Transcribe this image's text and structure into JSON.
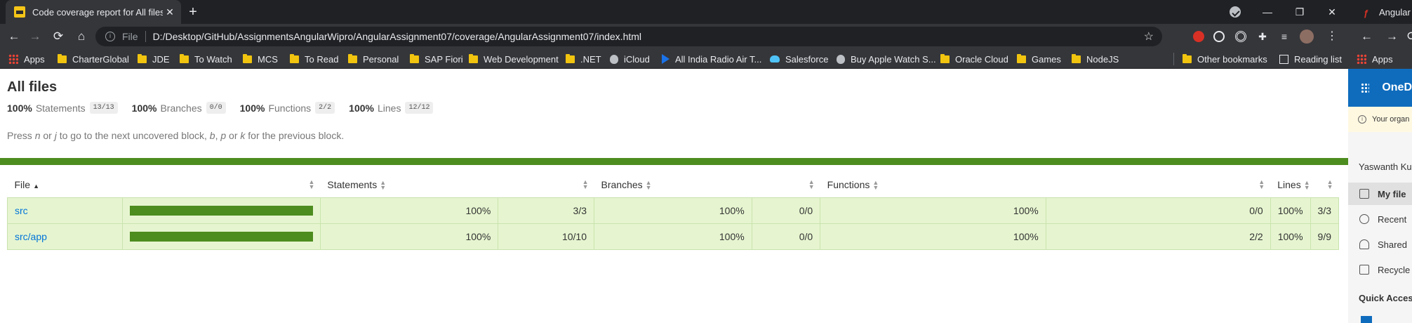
{
  "browser": {
    "tab_title": "Code coverage report for All files",
    "tab_close": "✕",
    "new_tab": "+",
    "window_controls": {
      "minimize": "—",
      "restore": "❐",
      "close": "✕"
    },
    "address": {
      "scheme": "File",
      "url": "D:/Desktop/GitHub/AssignmentsAngularWipro/AngularAssignment07/coverage/AngularAssignment07/index.html"
    },
    "nav": {
      "back": "←",
      "forward": "→",
      "reload": "⟳",
      "home": "⌂",
      "star": "☆",
      "puzzle": "✚",
      "menu": "⋮",
      "queue": "≡"
    },
    "bookmarks": [
      {
        "label": "Apps",
        "icon": "apps-grid-icon"
      },
      {
        "label": "CharterGlobal",
        "icon": "folder-icon"
      },
      {
        "label": "JDE",
        "icon": "folder-icon"
      },
      {
        "label": "To Watch",
        "icon": "folder-icon"
      },
      {
        "label": "MCS",
        "icon": "folder-icon"
      },
      {
        "label": "To Read",
        "icon": "folder-icon"
      },
      {
        "label": "Personal",
        "icon": "folder-icon"
      },
      {
        "label": "SAP Fiori",
        "icon": "folder-icon"
      },
      {
        "label": "Web Development",
        "icon": "folder-icon"
      },
      {
        "label": ".NET",
        "icon": "folder-icon"
      },
      {
        "label": "iCloud",
        "icon": "apple-icon"
      },
      {
        "label": "All India Radio Air T...",
        "icon": "play-icon"
      },
      {
        "label": "Salesforce",
        "icon": "cloud-icon"
      },
      {
        "label": "Buy Apple Watch S...",
        "icon": "apple-icon"
      },
      {
        "label": "Oracle Cloud",
        "icon": "folder-icon"
      },
      {
        "label": "Games",
        "icon": "folder-icon"
      },
      {
        "label": "NodeJS",
        "icon": "folder-icon"
      }
    ],
    "other_bookmarks": "Other bookmarks",
    "reading_list": "Reading list"
  },
  "report": {
    "title": "All files",
    "summary": [
      {
        "pct": "100%",
        "label": "Statements",
        "fraction": "13/13"
      },
      {
        "pct": "100%",
        "label": "Branches",
        "fraction": "0/0"
      },
      {
        "pct": "100%",
        "label": "Functions",
        "fraction": "2/2"
      },
      {
        "pct": "100%",
        "label": "Lines",
        "fraction": "12/12"
      }
    ],
    "hint": {
      "pre": "Press ",
      "n": "n",
      "or1": " or ",
      "j": "j",
      "mid": " to go to the next uncovered block, ",
      "b": "b",
      "comma": ", ",
      "p": "p",
      "or2": " or ",
      "k": "k",
      "post": " for the previous block."
    },
    "columns": {
      "file": "File",
      "statements": "Statements",
      "branches": "Branches",
      "functions": "Functions",
      "lines": "Lines"
    },
    "sort_asc": "▲",
    "sort_both": "▲▼",
    "rows": [
      {
        "file": "src",
        "coverage_fraction": 1.0,
        "statements_pct": "100%",
        "statements": "3/3",
        "branches_pct": "100%",
        "branches": "0/0",
        "functions_pct": "100%",
        "functions": "0/0",
        "lines_pct": "100%",
        "lines": "3/3"
      },
      {
        "file": "src/app",
        "coverage_fraction": 1.0,
        "statements_pct": "100%",
        "statements": "10/10",
        "branches_pct": "100%",
        "branches": "0/0",
        "functions_pct": "100%",
        "functions": "2/2",
        "lines_pct": "100%",
        "lines": "9/9"
      }
    ],
    "colors": {
      "status_bar": "#4d8c1f",
      "row_bg": "#e6f5d0",
      "link": "#0074d9"
    }
  },
  "second_window": {
    "tab_title": "Angular",
    "bookmark": "Apps",
    "app_title": "OneD",
    "notice": "Your organ",
    "user": "Yaswanth Ku",
    "nav": [
      "My file",
      "Recent",
      "Shared",
      "Recycle"
    ],
    "quick_access": "Quick Acces"
  }
}
